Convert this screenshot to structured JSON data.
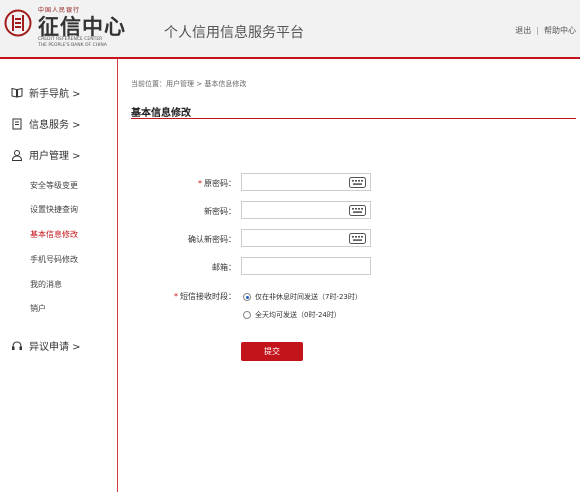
{
  "header": {
    "logo_top": "中国人民银行",
    "logo_cn": "征信中心",
    "logo_en1": "CREDIT REFERENCE CENTER",
    "logo_en2": "THE PEOPLE'S BANK OF CHINA",
    "site_title": "个人信用信息服务平台",
    "logout": "退出",
    "separator": "|",
    "help": "帮助中心"
  },
  "sidebar": {
    "main": [
      {
        "label": "新手导航 >",
        "icon": "book-icon"
      },
      {
        "label": "信息服务 >",
        "icon": "document-icon"
      },
      {
        "label": "用户管理 >",
        "icon": "user-icon"
      },
      {
        "label": "异议申请 >",
        "icon": "headset-icon"
      }
    ],
    "sub": [
      {
        "label": "安全等级变更"
      },
      {
        "label": "设置快捷查询"
      },
      {
        "label": "基本信息修改"
      },
      {
        "label": "手机号码修改"
      },
      {
        "label": "我的消息"
      },
      {
        "label": "销户"
      }
    ]
  },
  "breadcrumb": "当前位置：用户管理 > 基本信息修改",
  "page_title": "基本信息修改",
  "form": {
    "old_password": {
      "label": "原密码：",
      "required": "*"
    },
    "new_password": {
      "label": "新密码："
    },
    "confirm_password": {
      "label": "确认新密码："
    },
    "email": {
      "label": "邮箱："
    },
    "sms": {
      "label": "短信接收时段：",
      "required": "*",
      "options": [
        {
          "label": "仅在非休息时间发送（7时-23时）",
          "checked": true
        },
        {
          "label": "全天均可发送（0时-24时）",
          "checked": false
        }
      ]
    },
    "submit": "提交"
  },
  "colors": {
    "accent": "#c4141b",
    "header_bg": "#f2f2f2"
  }
}
